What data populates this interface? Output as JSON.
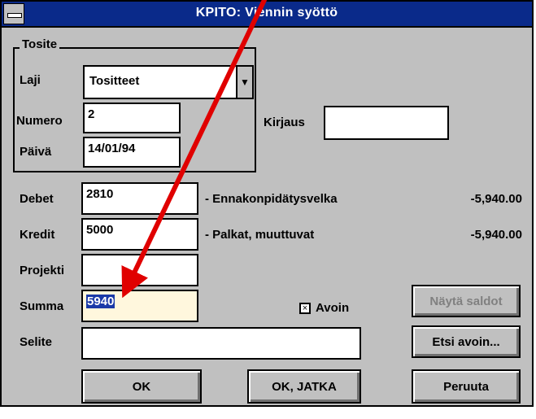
{
  "window": {
    "title": "KPITO: Viennin syöttö"
  },
  "tosite": {
    "group_label": "Tosite",
    "laji_label": "Laji",
    "laji_value": "Tositteet",
    "numero_label": "Numero",
    "numero_value": "2",
    "paiva_label": "Päivä",
    "paiva_value": "14/01/94"
  },
  "kirjaus": {
    "label": "Kirjaus",
    "value": ""
  },
  "debet": {
    "label": "Debet",
    "value": "2810",
    "description": "- Ennakonpidätysvelka",
    "amount": "-5,940.00"
  },
  "kredit": {
    "label": "Kredit",
    "value": "5000",
    "description": "- Palkat, muuttuvat",
    "amount": "-5,940.00"
  },
  "projekti": {
    "label": "Projekti",
    "value": ""
  },
  "summa": {
    "label": "Summa",
    "value": "5940"
  },
  "avoin": {
    "label": "Avoin",
    "checked": true
  },
  "selite": {
    "label": "Selite",
    "value": ""
  },
  "buttons": {
    "nayta_saldot": "Näytä saldot",
    "etsi_avoin": "Etsi avoin...",
    "ok": "OK",
    "ok_jatka": "OK, JATKA",
    "peruuta": "Peruuta"
  },
  "colors": {
    "titlebar": "#0a2a8a",
    "annotation_arrow": "#e00000"
  }
}
